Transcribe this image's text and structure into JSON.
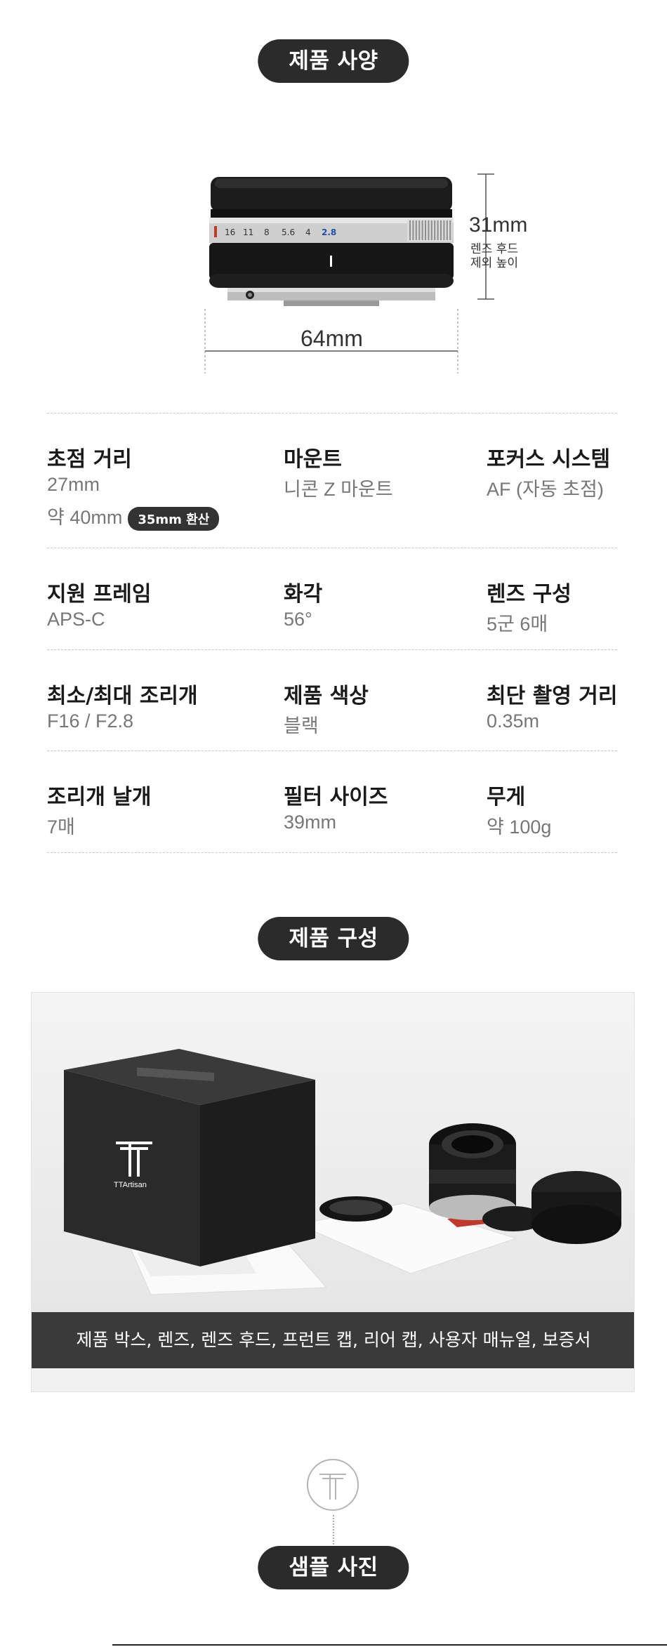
{
  "sections": {
    "specs_heading": "제품 사양",
    "contents_heading": "제품 구성",
    "samples_heading": "샘플 사진"
  },
  "diagram": {
    "width_label": "64mm",
    "height_label": "31mm",
    "height_note_1": "렌즈 후드",
    "height_note_2": "제외 높이",
    "aperture_scale": [
      "16",
      "11",
      "8",
      "5.6",
      "4",
      "2.8"
    ]
  },
  "specs": [
    {
      "title": "초점 거리",
      "value": "27mm",
      "value2": "약 40mm",
      "badge": "35mm 환산"
    },
    {
      "title": "마운트",
      "value": "니콘 Z 마운트"
    },
    {
      "title": "포커스 시스템",
      "value": "AF (자동 초점)"
    },
    {
      "title": "지원 프레임",
      "value": "APS-C"
    },
    {
      "title": "화각",
      "value": "56°"
    },
    {
      "title": "렌즈 구성",
      "value": "5군 6매"
    },
    {
      "title": "최소/최대 조리개",
      "value": "F16 / F2.8"
    },
    {
      "title": "제품 색상",
      "value": "블랙"
    },
    {
      "title": "최단 촬영 거리",
      "value": "0.35m"
    },
    {
      "title": "조리개 날개",
      "value": "7매"
    },
    {
      "title": "필터 사이즈",
      "value": "39mm"
    },
    {
      "title": "무게",
      "value": "약 100g"
    }
  ],
  "photo": {
    "brand": "TTArtisan",
    "caption": "제품 박스, 렌즈, 렌즈 후드, 프런트 캡, 리어 캡, 사용자 매뉴얼, 보증서"
  }
}
